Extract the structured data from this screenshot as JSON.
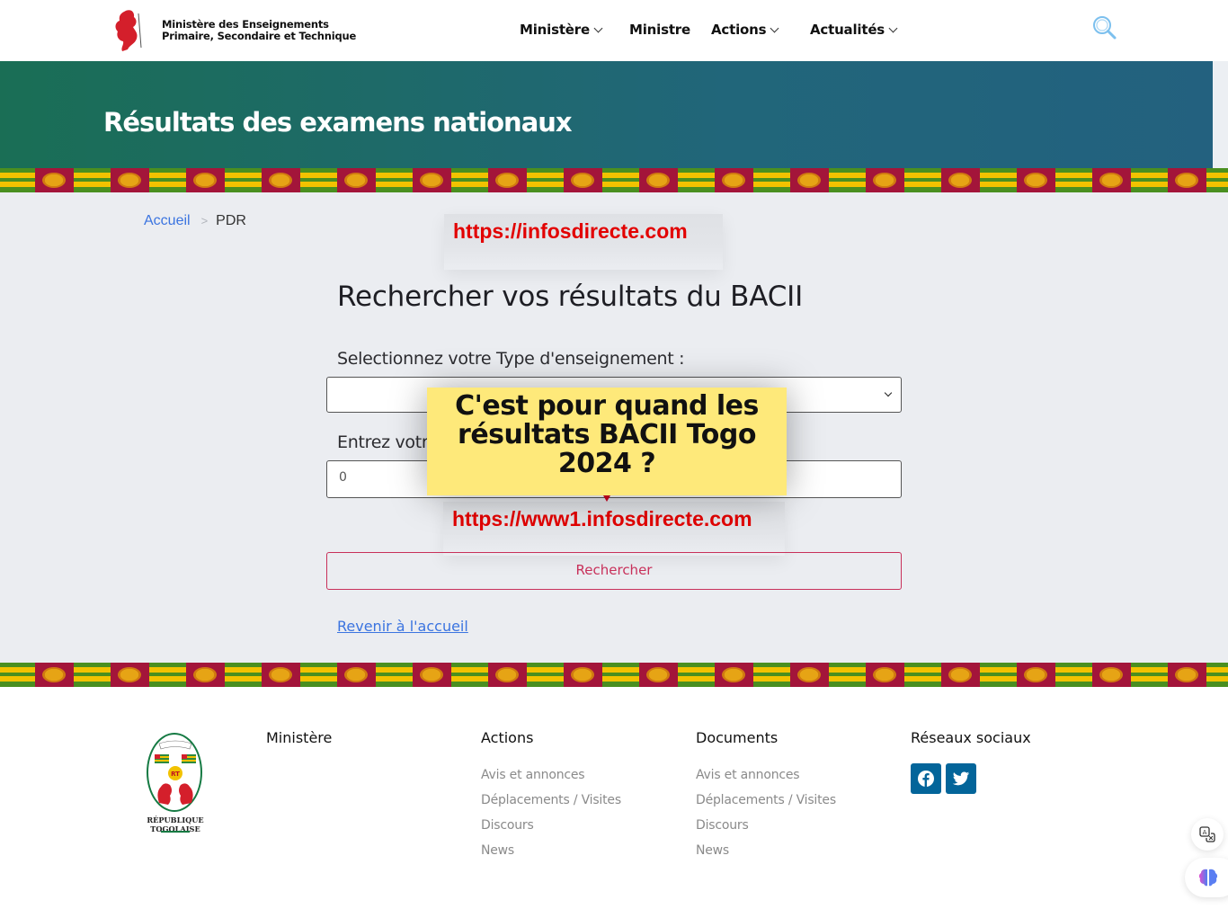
{
  "header": {
    "logo_line1": "Ministère des Enseignements",
    "logo_line2": "Primaire, Secondaire et Technique",
    "nav": [
      {
        "label": "Ministère",
        "has_dropdown": true
      },
      {
        "label": "Ministre",
        "has_dropdown": false
      },
      {
        "label": "Actions",
        "has_dropdown": true
      },
      {
        "label": "Actualités",
        "has_dropdown": true
      }
    ],
    "search_icon": "search-icon"
  },
  "hero": {
    "title": "Résultats des examens nationaux"
  },
  "breadcrumb": {
    "home": "Accueil",
    "separator": ">",
    "current": "PDR"
  },
  "overlay": {
    "url_top": "https://infosdirecte.com",
    "url_bottom": "https://www1.infosdirecte.com",
    "popup_line1": "C'est pour quand les",
    "popup_line2": "résultats BACII Togo",
    "popup_line3": "2024 ?"
  },
  "form": {
    "title": "Rechercher vos résultats du BACII",
    "select_label": "Selectionnez votre Type d'enseignement :",
    "select_value": "",
    "input_label": "Entrez votre numéro de table :",
    "input_value": "0",
    "submit_label": "Rechercher",
    "back_link": "Revenir à l'accueil"
  },
  "footer": {
    "emblem_caption": "RÉPUBLIQUE TOGOLAISE",
    "emblem_badge": "RT",
    "columns": [
      {
        "heading": "Ministère",
        "links": []
      },
      {
        "heading": "Actions",
        "links": [
          "Avis et annonces",
          "Déplacements / Visites",
          "Discours",
          "News"
        ]
      },
      {
        "heading": "Documents",
        "links": [
          "Avis et annonces",
          "Déplacements / Visites",
          "Discours",
          "News"
        ]
      },
      {
        "heading": "Réseaux sociaux",
        "links": []
      }
    ],
    "social": [
      "facebook-icon",
      "twitter-icon"
    ]
  },
  "colors": {
    "accent_link": "#3b74e0",
    "button_border": "#c8305a",
    "hero_start": "#1a6e55",
    "hero_end": "#23617f",
    "social_bg": "#03659a",
    "popup_bg": "#fee97a",
    "ad_url": "#e20000"
  }
}
